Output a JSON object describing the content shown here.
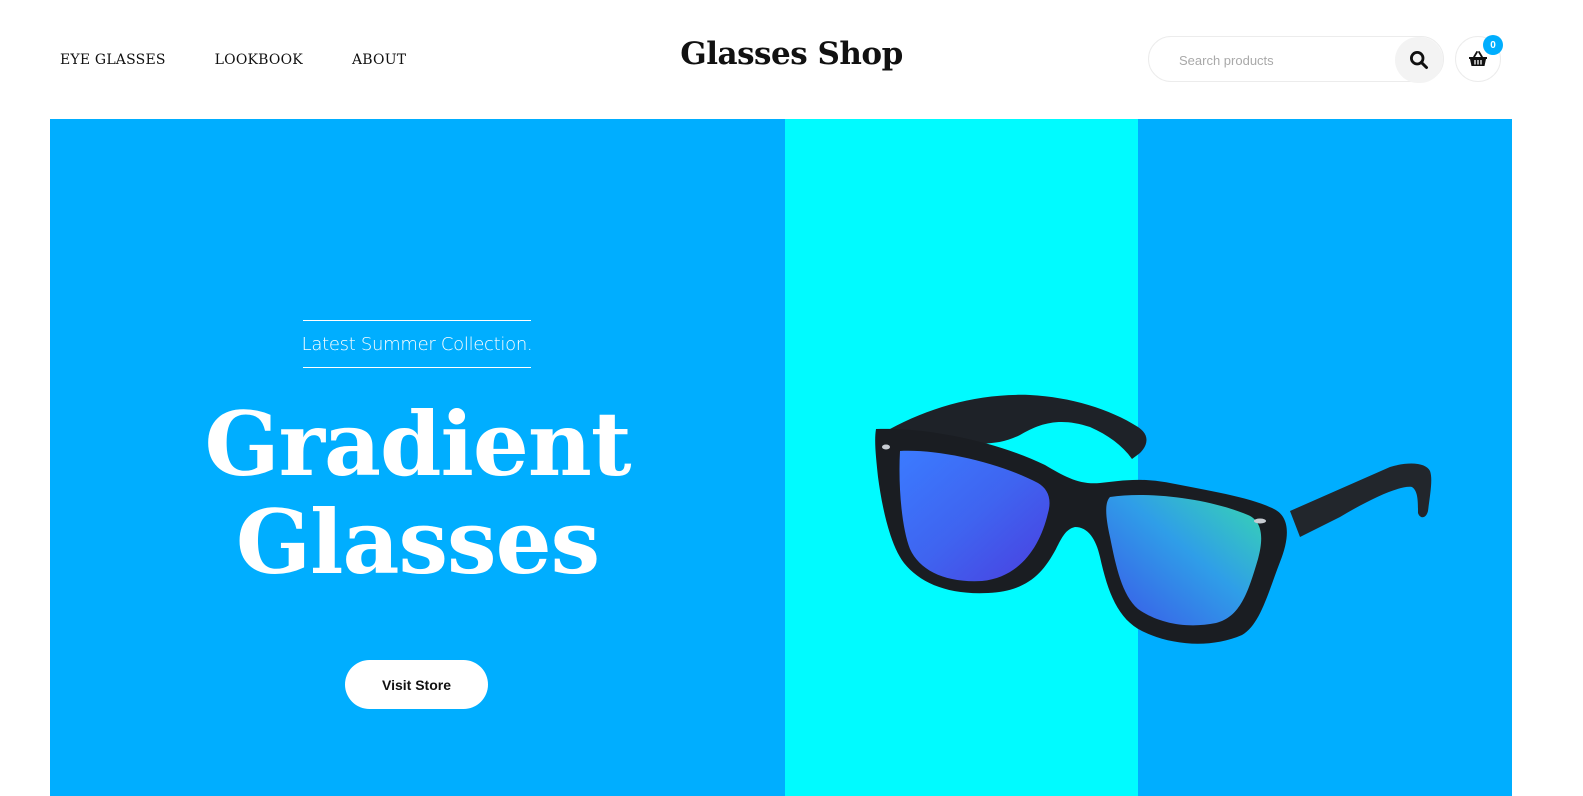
{
  "header": {
    "nav": [
      {
        "label": "EYE GLASSES"
      },
      {
        "label": "LOOKBOOK"
      },
      {
        "label": "ABOUT"
      }
    ],
    "logo": "Glasses Shop",
    "search": {
      "placeholder": "Search products",
      "icon": "search-icon"
    },
    "cart": {
      "icon": "basket-icon",
      "count": "0",
      "badge_color": "#00aefe"
    }
  },
  "hero": {
    "subtitle": "Latest Summer Collection.",
    "title_line1": "Gradient",
    "title_line2": "Glasses",
    "cta_label": "Visit Store",
    "background_color": "#00aeff",
    "stripe_color": "#00fbff",
    "image": "sunglasses-product-image"
  }
}
